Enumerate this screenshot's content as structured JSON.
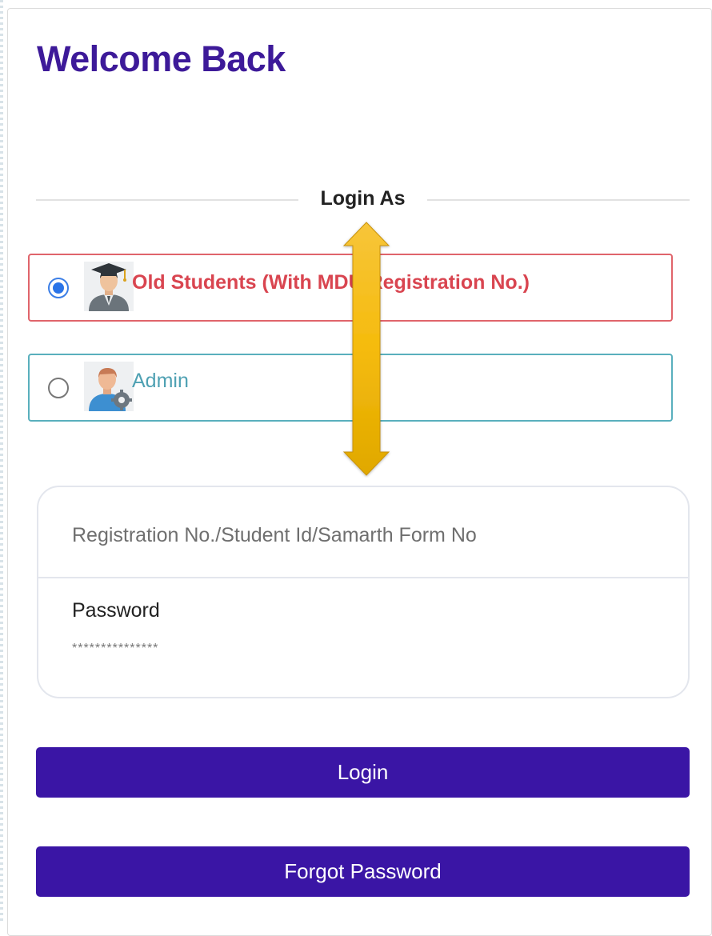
{
  "page": {
    "title": "Welcome Back"
  },
  "login_as": {
    "label": "Login As"
  },
  "options": [
    {
      "label": "Old Students (With MDU Registration No.)",
      "selected": true,
      "icon": "student-graduate-icon",
      "border_color": "#e0646b",
      "text_color": "#d94550"
    },
    {
      "label": "Admin",
      "selected": false,
      "icon": "admin-user-gear-icon",
      "border_color": "#59afbd",
      "text_color": "#4fa1b3"
    }
  ],
  "form": {
    "registration": {
      "placeholder": "Registration No./Student Id/Samarth Form No",
      "value": ""
    },
    "password": {
      "label": "Password",
      "placeholder": "***************",
      "value": ""
    }
  },
  "buttons": {
    "login": "Login",
    "forgot_password": "Forgot Password"
  },
  "overlay": {
    "icon": "double-headed-arrow-icon",
    "color": "#f2b705"
  },
  "colors": {
    "brand": "#3a15a5",
    "title": "#3d1a99",
    "radio_selected": "#2a74e8"
  }
}
